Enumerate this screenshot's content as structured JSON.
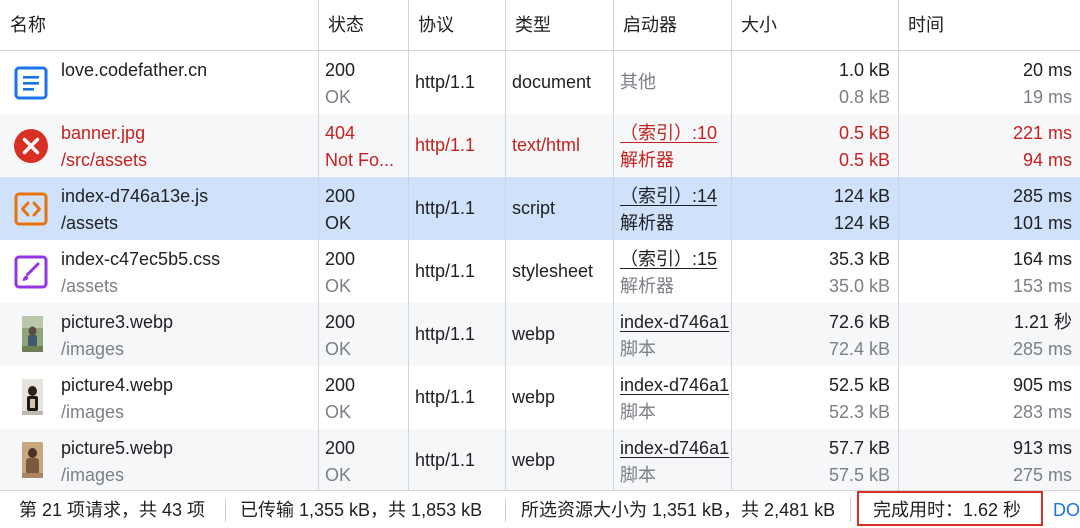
{
  "columns": [
    "名称",
    "状态",
    "协议",
    "类型",
    "启动器",
    "大小",
    "时间"
  ],
  "rows": [
    {
      "icon": "document-icon",
      "name": "love.codefather.cn",
      "path": "",
      "status": "200",
      "status_text": "OK",
      "protocol": "http/1.1",
      "type": "document",
      "initiator": "其他",
      "initiator_sub": "",
      "size": "1.0 kB",
      "size_sub": "0.8 kB",
      "time": "20 ms",
      "time_sub": "19 ms"
    },
    {
      "icon": "error-icon",
      "name": "banner.jpg",
      "path": "/src/assets",
      "status": "404",
      "status_text": "Not Fo...",
      "protocol": "http/1.1",
      "type": "text/html",
      "initiator": "（索引）:10",
      "initiator_sub": "解析器",
      "size": "0.5 kB",
      "size_sub": "0.5 kB",
      "time": "221 ms",
      "time_sub": "94 ms"
    },
    {
      "icon": "script-icon",
      "name": "index-d746a13e.js",
      "path": "/assets",
      "status": "200",
      "status_text": "OK",
      "protocol": "http/1.1",
      "type": "script",
      "initiator": "（索引）:14",
      "initiator_sub": "解析器",
      "size": "124 kB",
      "size_sub": "124 kB",
      "time": "285 ms",
      "time_sub": "101 ms"
    },
    {
      "icon": "stylesheet-icon",
      "name": "index-c47ec5b5.css",
      "path": "/assets",
      "status": "200",
      "status_text": "OK",
      "protocol": "http/1.1",
      "type": "stylesheet",
      "initiator": "（索引）:15",
      "initiator_sub": "解析器",
      "size": "35.3 kB",
      "size_sub": "35.0 kB",
      "time": "164 ms",
      "time_sub": "153 ms"
    },
    {
      "icon": "image-thumbnail-icon",
      "name": "picture3.webp",
      "path": "/images",
      "status": "200",
      "status_text": "OK",
      "protocol": "http/1.1",
      "type": "webp",
      "initiator": "index-d746a1",
      "initiator_sub": "脚本",
      "size": "72.6 kB",
      "size_sub": "72.4 kB",
      "time": "1.21 秒",
      "time_sub": "285 ms"
    },
    {
      "icon": "image-thumbnail-icon",
      "name": "picture4.webp",
      "path": "/images",
      "status": "200",
      "status_text": "OK",
      "protocol": "http/1.1",
      "type": "webp",
      "initiator": "index-d746a1",
      "initiator_sub": "脚本",
      "size": "52.5 kB",
      "size_sub": "52.3 kB",
      "time": "905 ms",
      "time_sub": "283 ms"
    },
    {
      "icon": "image-thumbnail-icon",
      "name": "picture5.webp",
      "path": "/images",
      "status": "200",
      "status_text": "OK",
      "protocol": "http/1.1",
      "type": "webp",
      "initiator": "index-d746a1",
      "initiator_sub": "脚本",
      "size": "57.7 kB",
      "size_sub": "57.5 kB",
      "time": "913 ms",
      "time_sub": "275 ms"
    }
  ],
  "footer": {
    "requests": "第 21 项请求，共 43 项",
    "transferred": "已传输 1,355 kB，共 1,853 kB",
    "resources": "所选资源大小为 1,351 kB，共 2,481 kB",
    "finish": "完成用时：1.62 秒",
    "dom": "DO"
  },
  "colors": {
    "error": "#c5221f",
    "selected": "#cfe1fb",
    "document": "#1a73e8",
    "script": "#e8710a",
    "stylesheet": "#9334e6",
    "highlight_box": "#d93025"
  }
}
